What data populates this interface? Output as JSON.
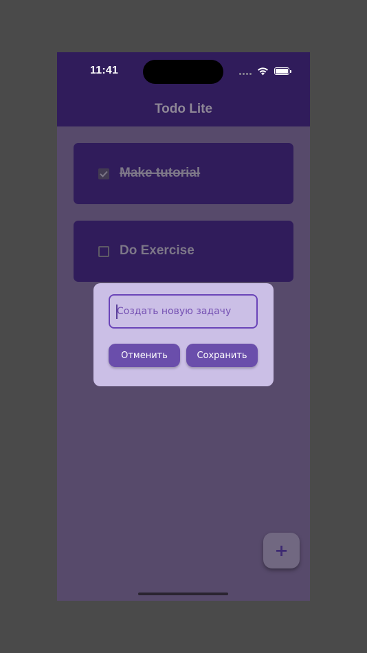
{
  "status_bar": {
    "time": "11:41"
  },
  "header": {
    "title": "Todo Lite"
  },
  "tasks": [
    {
      "label": "Make tutorial",
      "completed": true
    },
    {
      "label": "Do Exercise",
      "completed": false
    }
  ],
  "dialog": {
    "input_value": "",
    "input_placeholder": "Создать новую задачу",
    "cancel_label": "Отменить",
    "save_label": "Сохранить"
  },
  "fab": {
    "icon": "plus-icon",
    "glyph": "+"
  },
  "colors": {
    "app_bar": "#301c5b",
    "background_scrim": "#574a6b",
    "dialog_bg": "#cbbfe6",
    "button_bg": "#6a4eab",
    "input_border": "#6a44b8"
  }
}
